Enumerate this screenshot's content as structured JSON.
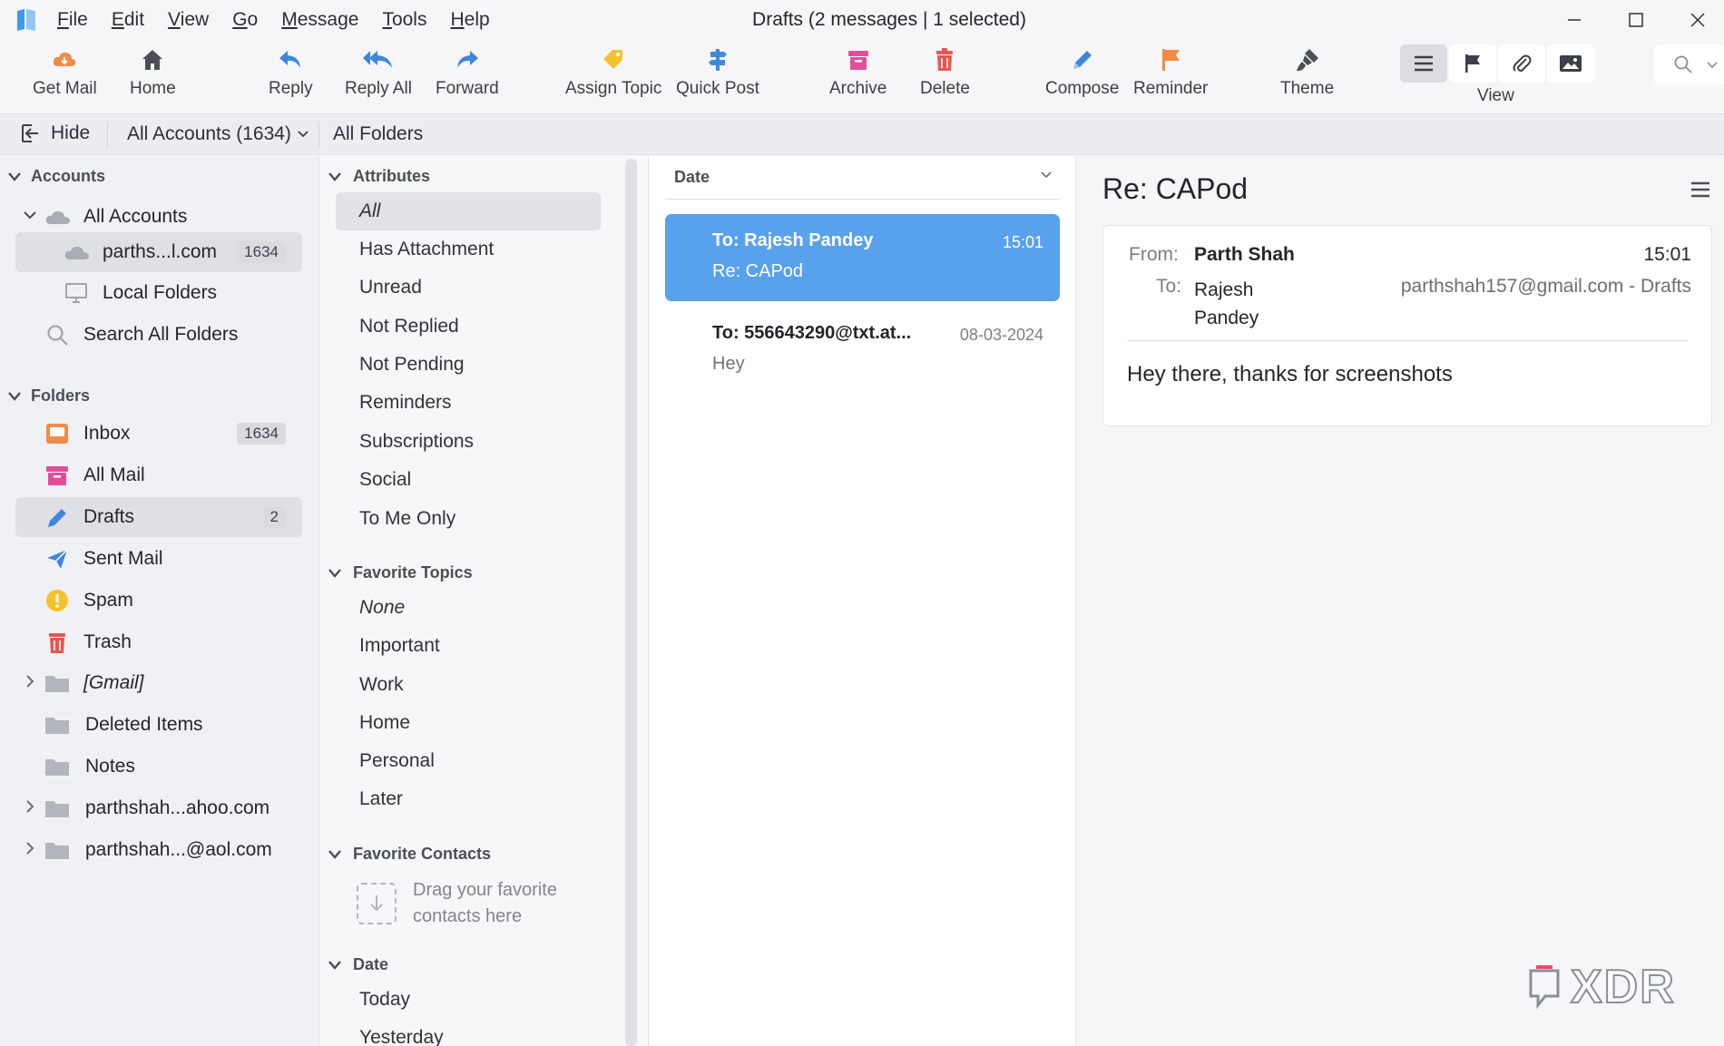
{
  "window": {
    "title": "Drafts (2 messages | 1 selected)"
  },
  "menu": [
    "File",
    "Edit",
    "View",
    "Go",
    "Message",
    "Tools",
    "Help"
  ],
  "toolbar": {
    "buttons": [
      {
        "label": "Get Mail",
        "icon": "cloud-download-icon"
      },
      {
        "label": "Home",
        "icon": "home-icon"
      },
      {
        "label": "Reply",
        "icon": "reply-icon"
      },
      {
        "label": "Reply All",
        "icon": "reply-all-icon"
      },
      {
        "label": "Forward",
        "icon": "forward-icon"
      },
      {
        "label": "Assign Topic",
        "icon": "tag-icon"
      },
      {
        "label": "Quick Post",
        "icon": "signpost-icon"
      },
      {
        "label": "Archive",
        "icon": "archive-icon"
      },
      {
        "label": "Delete",
        "icon": "trash-icon"
      },
      {
        "label": "Compose",
        "icon": "pencil-icon"
      },
      {
        "label": "Reminder",
        "icon": "flag-icon"
      },
      {
        "label": "Theme",
        "icon": "paintbrush-icon"
      }
    ],
    "view_label": "View"
  },
  "locbar": {
    "hide_label": "Hide",
    "accounts_label": "All Accounts (1634)",
    "folders_label": "All Folders"
  },
  "sidebar": {
    "accounts_heading": "Accounts",
    "all_accounts": "All Accounts",
    "account_name": "parths...l.com",
    "account_count": "1634",
    "local_folders": "Local Folders",
    "search_all": "Search All Folders",
    "folders_heading": "Folders",
    "folders": [
      {
        "label": "Inbox",
        "count": "1634"
      },
      {
        "label": "All Mail",
        "count": ""
      },
      {
        "label": "Drafts",
        "count": "2"
      },
      {
        "label": "Sent Mail",
        "count": ""
      },
      {
        "label": "Spam",
        "count": ""
      },
      {
        "label": "Trash",
        "count": ""
      },
      {
        "label": "[Gmail]",
        "count": ""
      },
      {
        "label": "Deleted Items",
        "count": ""
      },
      {
        "label": "Notes",
        "count": ""
      },
      {
        "label": "parthshah...ahoo.com",
        "count": ""
      },
      {
        "label": "parthshah...@aol.com",
        "count": ""
      }
    ]
  },
  "filters": {
    "attributes_heading": "Attributes",
    "attributes": [
      "All",
      "Has Attachment",
      "Unread",
      "Not Replied",
      "Not Pending",
      "Reminders",
      "Subscriptions",
      "Social",
      "To Me Only"
    ],
    "topics_heading": "Favorite Topics",
    "topics": [
      "None",
      "Important",
      "Work",
      "Home",
      "Personal",
      "Later"
    ],
    "contacts_heading": "Favorite Contacts",
    "contacts_hint": "Drag your favorite contacts here",
    "date_heading": "Date",
    "dates": [
      "Today",
      "Yesterday"
    ]
  },
  "message_list": {
    "sort_label": "Date",
    "messages": [
      {
        "to": "To: Rajesh Pandey",
        "subject": "Re: CAPod",
        "time": "15:01"
      },
      {
        "to": "To: 556643290@txt.at...",
        "subject": "Hey",
        "time": "08-03-2024"
      }
    ]
  },
  "reader": {
    "title": "Re: CAPod",
    "from_label": "From:",
    "from": "Parth Shah",
    "to_label": "To:",
    "to": "Rajesh Pandey",
    "time": "15:01",
    "account": "parthshah157@gmail.com - Drafts",
    "body": "Hey there, thanks for screenshots"
  },
  "watermark": "XDR",
  "colors": {
    "accent": "#58a1ec",
    "selection": "#dfe0e5"
  }
}
